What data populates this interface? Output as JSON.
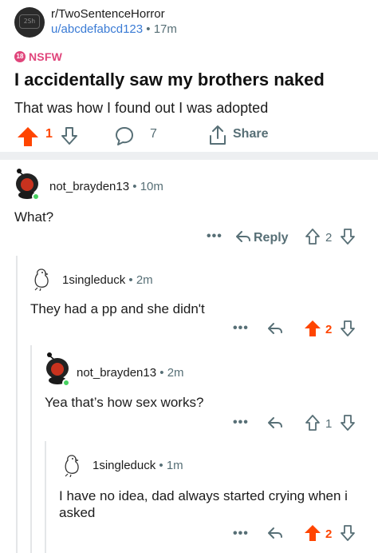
{
  "post": {
    "subreddit": "r/TwoSentenceHorror",
    "author": "u/abcdefabcd123",
    "separator": "•",
    "age": "17m",
    "nsfw_badge": "18",
    "nsfw_label": "NSFW",
    "title": "I accidentally saw my brothers naked",
    "body": "That was how I found out I was adopted",
    "score": "1",
    "upvoted": true,
    "comment_count": "7",
    "share_label": "Share"
  },
  "comments": [
    {
      "author": "not_brayden13",
      "separator": "•",
      "age": "10m",
      "text": "What?",
      "reply_label": "Reply",
      "score": "2",
      "upvoted": false,
      "more": "•••"
    },
    {
      "author": "1singleduck",
      "separator": "•",
      "age": "2m",
      "text": "They had a pp and she didn't",
      "score": "2",
      "upvoted": true,
      "more": "•••"
    },
    {
      "author": "not_brayden13",
      "separator": "•",
      "age": "2m",
      "text": "Yea that’s how sex works?",
      "score": "1",
      "upvoted": false,
      "more": "•••"
    },
    {
      "author": "1singleduck",
      "separator": "•",
      "age": "1m",
      "text_line1": "I have no idea, dad always started crying when i",
      "text_line2": "asked",
      "score": "2",
      "upvoted": true,
      "more": "•••"
    }
  ],
  "icons": {
    "subreddit_avatar": "2Sh",
    "upvote": "arrow-up-icon",
    "downvote": "arrow-down-icon",
    "comment": "speech-bubble-icon",
    "share": "share-icon",
    "reply": "reply-arrow-icon",
    "more": "more-dots-icon"
  },
  "colors": {
    "upvote": "#ff4500",
    "nsfw": "#e0457b",
    "username_link": "#3a7bd5",
    "muted": "#576f76",
    "online": "#46d160"
  }
}
